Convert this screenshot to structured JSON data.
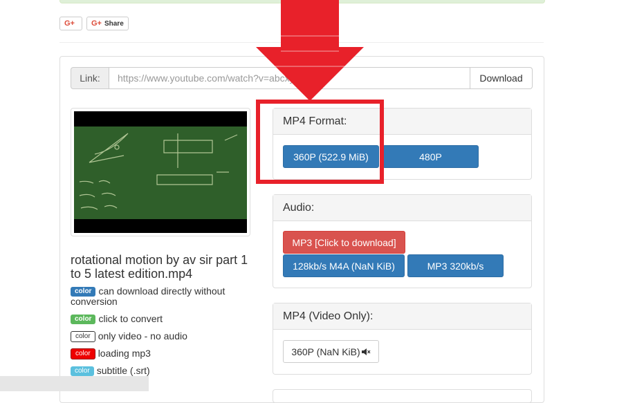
{
  "social": {
    "gplus_label": "G+",
    "share_label": "Share"
  },
  "link": {
    "label": "Link:",
    "value": "https://www.youtube.com/watch?v=abcxyz",
    "download_label": "Download"
  },
  "video": {
    "title": "rotational motion by av sir part 1 to 5 latest edition.mp4"
  },
  "legend": [
    {
      "tag": "color",
      "text": "can download directly without conversion"
    },
    {
      "tag": "color",
      "text": "click to convert"
    },
    {
      "tag": "color",
      "text": "only video - no audio"
    },
    {
      "tag": "color",
      "text": "loading mp3"
    },
    {
      "tag": "color",
      "text": "subtitle (.srt)"
    }
  ],
  "mp4_format": {
    "title": "MP4 Format:",
    "buttons": [
      "360P (522.9 MiB)",
      "480P"
    ]
  },
  "audio": {
    "title": "Audio:",
    "convert_button": "MP3 [Click to download]",
    "buttons": [
      "128kb/s M4A (NaN KiB)",
      "MP3 320kb/s"
    ]
  },
  "mp4_video_only": {
    "title": "MP4 (Video Only):",
    "buttons": [
      "360P (NaN KiB)"
    ]
  },
  "colors": {
    "primary": "#337ab7",
    "danger": "#d9534f",
    "success": "#5cb85c",
    "info": "#5bc0de",
    "annotation_red": "#e8212a"
  },
  "icons": [
    "gplus-icon",
    "mute-icon",
    "down-arrow-annotation"
  ]
}
